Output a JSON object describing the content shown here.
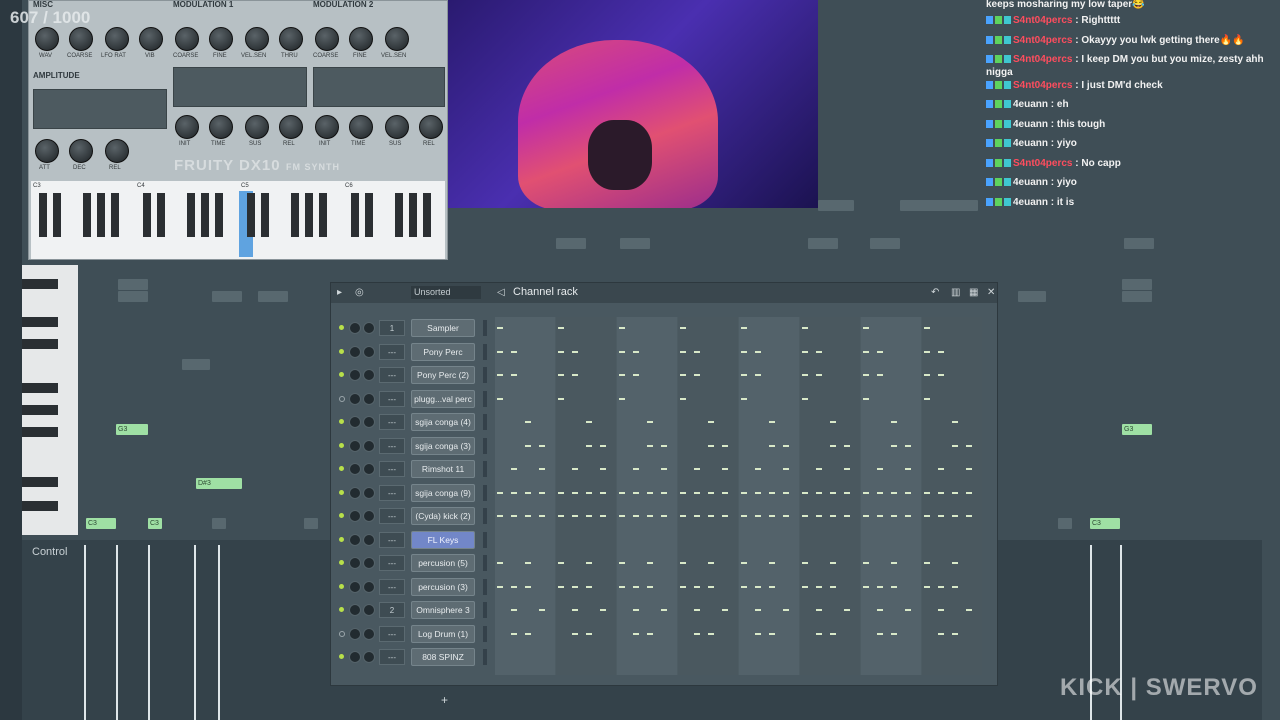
{
  "counter": "607 / 1000",
  "dx10": {
    "sections": {
      "misc": "MISC",
      "mod1": "MODULATION 1",
      "mod2": "MODULATION 2",
      "amplitude": "AMPLITUDE"
    },
    "knob_labels_top": [
      "WAV",
      "COARSE",
      "LFO RAT",
      "VIB",
      "COARSE",
      "FINE",
      "VEL.SEN",
      "THRU",
      "COARSE",
      "FINE",
      "VEL.SEN"
    ],
    "knob_labels_bottom": [
      "ATT",
      "DEC",
      "REL",
      "INIT",
      "TIME",
      "SUS",
      "REL",
      "INIT",
      "TIME",
      "SUS",
      "REL"
    ],
    "logo": "FRUITY DX10",
    "logo_sub": "FM SYNTH",
    "octaves": [
      "C3",
      "C4",
      "C5",
      "C6"
    ]
  },
  "chat": [
    {
      "user": "",
      "text": "keeps mosharing my low taper😂",
      "red": false
    },
    {
      "user": "S4nt04percs",
      "text": " : Righttttt",
      "red": true
    },
    {
      "user": "S4nt04percs",
      "text": " : Okayyy you lwk getting there🔥🔥",
      "red": true
    },
    {
      "user": "S4nt04percs",
      "text": " : I keep DM you but you mize, zesty ahh nigga",
      "red": true
    },
    {
      "user": "S4nt04percs",
      "text": " : I just DM'd check",
      "red": true
    },
    {
      "user": "4euann",
      "text": " : eh",
      "red": false
    },
    {
      "user": "4euann",
      "text": " : this tough",
      "red": false
    },
    {
      "user": "4euann",
      "text": " : yiyo",
      "red": false
    },
    {
      "user": "S4nt04percs",
      "text": " : No capp",
      "red": true
    },
    {
      "user": "4euann",
      "text": " : yiyo",
      "red": false
    },
    {
      "user": "4euann",
      "text": " : it is",
      "red": false
    }
  ],
  "rack": {
    "title": "Channel rack",
    "filter": "Unsorted",
    "add": "+",
    "channels": [
      {
        "name": "Sampler",
        "route": "1",
        "on": true
      },
      {
        "name": "Pony Perc",
        "route": "---",
        "on": true
      },
      {
        "name": "Pony Perc (2)",
        "route": "---",
        "on": true
      },
      {
        "name": "plugg...val perc",
        "route": "---",
        "on": false
      },
      {
        "name": "sgija conga (4)",
        "route": "---",
        "on": true
      },
      {
        "name": "sgija conga (3)",
        "route": "---",
        "on": true
      },
      {
        "name": "Rimshot 11",
        "route": "---",
        "on": true
      },
      {
        "name": "sgija conga (9)",
        "route": "---",
        "on": true
      },
      {
        "name": "(Cyda) kick (2)",
        "route": "---",
        "on": true
      },
      {
        "name": "FL Keys",
        "route": "---",
        "on": true,
        "selected": true
      },
      {
        "name": "percusion (5)",
        "route": "---",
        "on": true
      },
      {
        "name": "percusion (3)",
        "route": "---",
        "on": true
      },
      {
        "name": "Omnisphere 3",
        "route": "2",
        "on": true
      },
      {
        "name": "Log Drum (1)",
        "route": "---",
        "on": false
      },
      {
        "name": "808 SPINZ",
        "route": "---",
        "on": true
      }
    ]
  },
  "piano_roll": {
    "control_label": "Control",
    "notes": [
      "G3",
      "D#3",
      "C3",
      "C3",
      "G3",
      "C3"
    ]
  },
  "watermark": "KICK | SWERVO"
}
